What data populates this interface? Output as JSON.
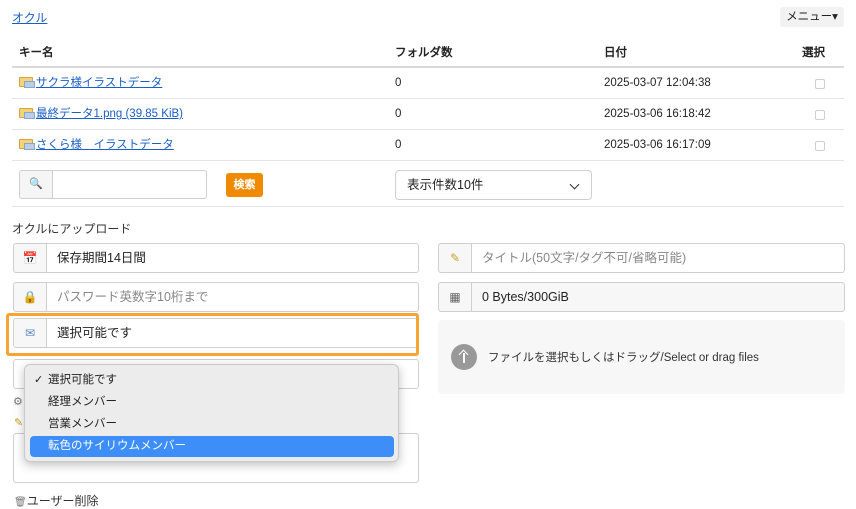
{
  "header": {
    "brand": "オクル",
    "menu_label": "メニュー▾"
  },
  "table": {
    "columns": [
      "キー名",
      "フォルダ数",
      "日付",
      "選択"
    ],
    "rows": [
      {
        "name": "サクラ様イラストデータ",
        "count": "0",
        "date": "2025-03-07 12:04:38"
      },
      {
        "name": "最終データ1.png (39.85 KiB)",
        "count": "0",
        "date": "2025-03-06 16:18:42"
      },
      {
        "name": "さくら様　イラストデータ",
        "count": "0",
        "date": "2025-03-06 16:17:09"
      }
    ]
  },
  "search": {
    "icon": "🔍",
    "button_label": "検索",
    "page_size_value": "表示件数10件"
  },
  "upload": {
    "heading": "オクルにアップロード",
    "retention_value": "保存期間14日間",
    "password_placeholder": "パスワード英数字10桁まで",
    "recipient_value": "選択可能です",
    "title_placeholder": "タイトル(50文字/タグ不可/省略可能)",
    "storage_value": "0 Bytes/300GiB",
    "drop_text": "ファイルを選択もしくはドラッグ/Select or drag files",
    "delete_user_label": "ユーザー削除"
  },
  "dropdown": {
    "options": [
      "選択可能です",
      "経理メンバー",
      "営業メンバー",
      "転色のサイリウムメンバー"
    ],
    "selected": "選択可能です",
    "highlighted": "転色のサイリウムメンバー",
    "check_mark": "✓"
  },
  "icons": {
    "calendar": "📅",
    "lock": "🔒",
    "mail": "✉",
    "pencil": "✎",
    "storage": "▦",
    "gear": "⚙",
    "trash": "🗑"
  },
  "colors": {
    "accent_orange": "#f08a00",
    "highlight_border": "#f7a532",
    "menu_selection": "#3d8ef8",
    "link": "#1a5fc7"
  }
}
